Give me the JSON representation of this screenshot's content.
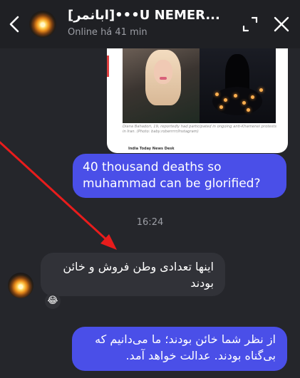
{
  "header": {
    "title": "[ابانمر]•••U NEMER...",
    "status": "Online há 41 min"
  },
  "media": {
    "caption": "Diana Bahadori, 19, reportedly had participated in ongoing anti-Khamenei protests in Iran. (Photo: baby.roberrrrr/Instagram)",
    "source": "India Today News Desk"
  },
  "messages": {
    "outgoing_1": "40 thousand deaths so muhammad can be glorified?",
    "timestamp": "16:24",
    "incoming_1": "اینها تعدادی وطن فروش و خائن بودند",
    "reaction": "😂",
    "outgoing_2": "از نظر شما خائن بودند؛ ما می‌دانیم که بی‌گناه بودند. عدالت خواهد آمد."
  },
  "colors": {
    "outgoing_bubble": "#4a4fe8",
    "incoming_bubble": "#313238",
    "background": "#25262b",
    "annotation_arrow": "#e81c1c"
  }
}
